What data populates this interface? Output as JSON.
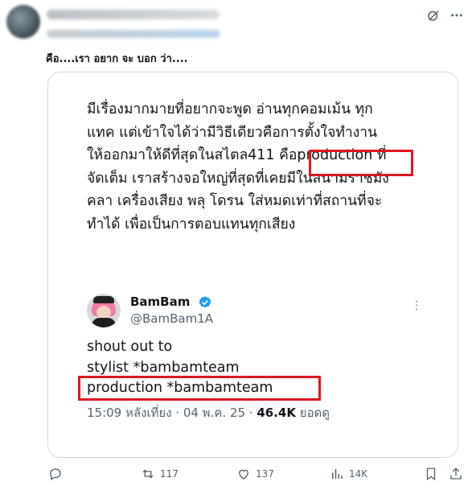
{
  "post": {
    "comment": "คือ....เรา อยาก จะ บอก ว่า...."
  },
  "quoted_card": {
    "thai_lines": [
      "มีเรื่องมากมายที่อยากจะพูด อ่านทุกคอมเม้น ทุก",
      "แทค แต่เข้าใจได้ว่ามีวิธีเดียวคือการตั้งใจทำงาน",
      "ให้ออกมาให้ดีที่สุดในสไตล411 คือproduction ที่",
      "จัดเต็ม เราสร้างจอใหญ่ที่สุดที่เคยมีในสนามราชมัง",
      "คลา เครื่องเสียง พลุ โดรน ใส่หมดเท่าที่สถานที่จะ",
      "ทำได้ เพื่อเป็นการตอบแทนทุกเสียง"
    ],
    "quote": {
      "name": "BamBam",
      "handle": "@BamBam1A",
      "lines": [
        "shout out to",
        "stylist *bambamteam",
        "production *bambamteam"
      ],
      "time": "15:09 หลังเที่ยง · 04 พ.ค. 25 · ",
      "views": "46.4K",
      "views_label": " ยอดดู"
    }
  },
  "actions": {
    "reply_count": "",
    "retweet_count": "117",
    "like_count": "137",
    "views_count": "14K"
  },
  "icons": {
    "top": [
      "grok-icon",
      "more-icon"
    ],
    "actions": [
      "reply-icon",
      "retweet-icon",
      "like-icon",
      "views-icon",
      "bookmark-icon",
      "share-icon"
    ]
  },
  "colors": {
    "highlight_box": "#e0161e",
    "verified": "#1d9bf0",
    "muted_text": "#536471"
  }
}
